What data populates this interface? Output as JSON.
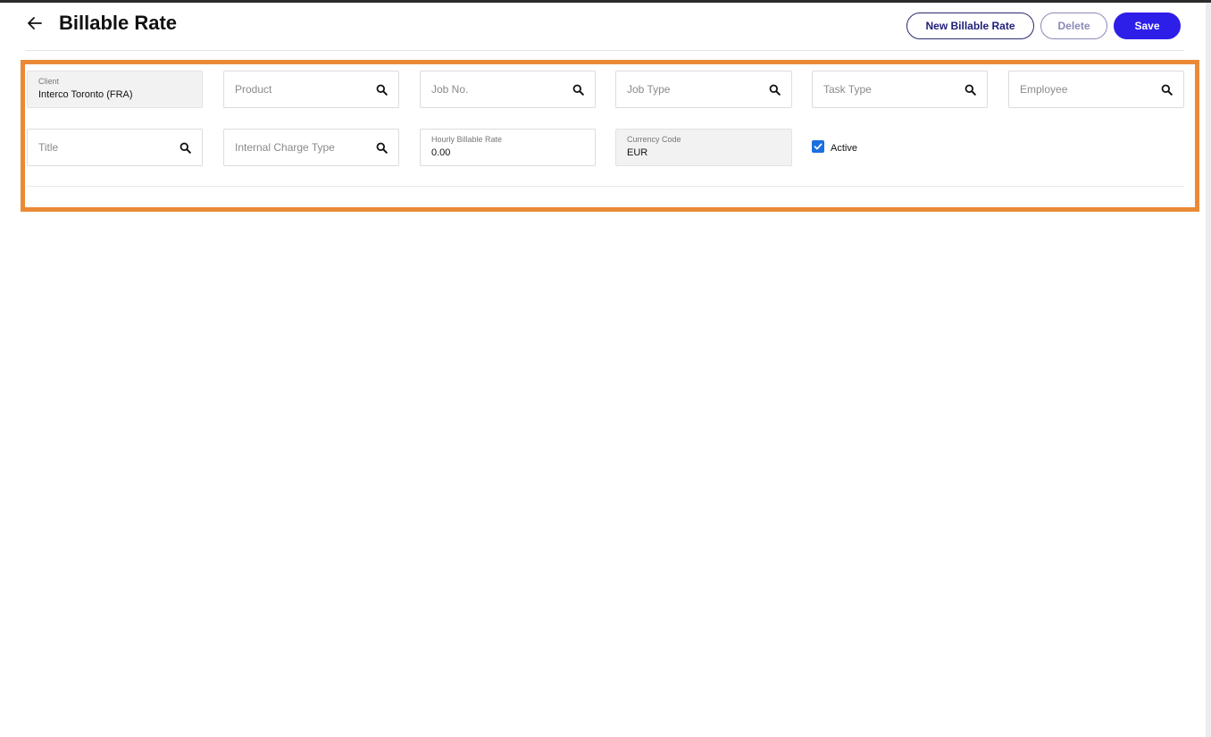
{
  "header": {
    "title": "Billable Rate",
    "buttons": {
      "new": "New Billable Rate",
      "delete": "Delete",
      "save": "Save"
    }
  },
  "form": {
    "client": {
      "label": "Client",
      "value": "Interco Toronto (FRA)"
    },
    "product": {
      "placeholder": "Product"
    },
    "job_no": {
      "placeholder": "Job No."
    },
    "job_type": {
      "placeholder": "Job Type"
    },
    "task_type": {
      "placeholder": "Task Type"
    },
    "employee": {
      "placeholder": "Employee"
    },
    "title": {
      "placeholder": "Title"
    },
    "internal_charge_type": {
      "placeholder": "Internal Charge Type"
    },
    "hourly_billable_rate": {
      "label": "Hourly Billable Rate",
      "value": "0.00"
    },
    "currency_code": {
      "label": "Currency Code",
      "value": "EUR"
    },
    "active": {
      "label": "Active",
      "checked": true
    }
  },
  "colors": {
    "accent": "#2d1ee8",
    "highlight": "#ea8a37",
    "checkbox": "#1a6fe0"
  }
}
